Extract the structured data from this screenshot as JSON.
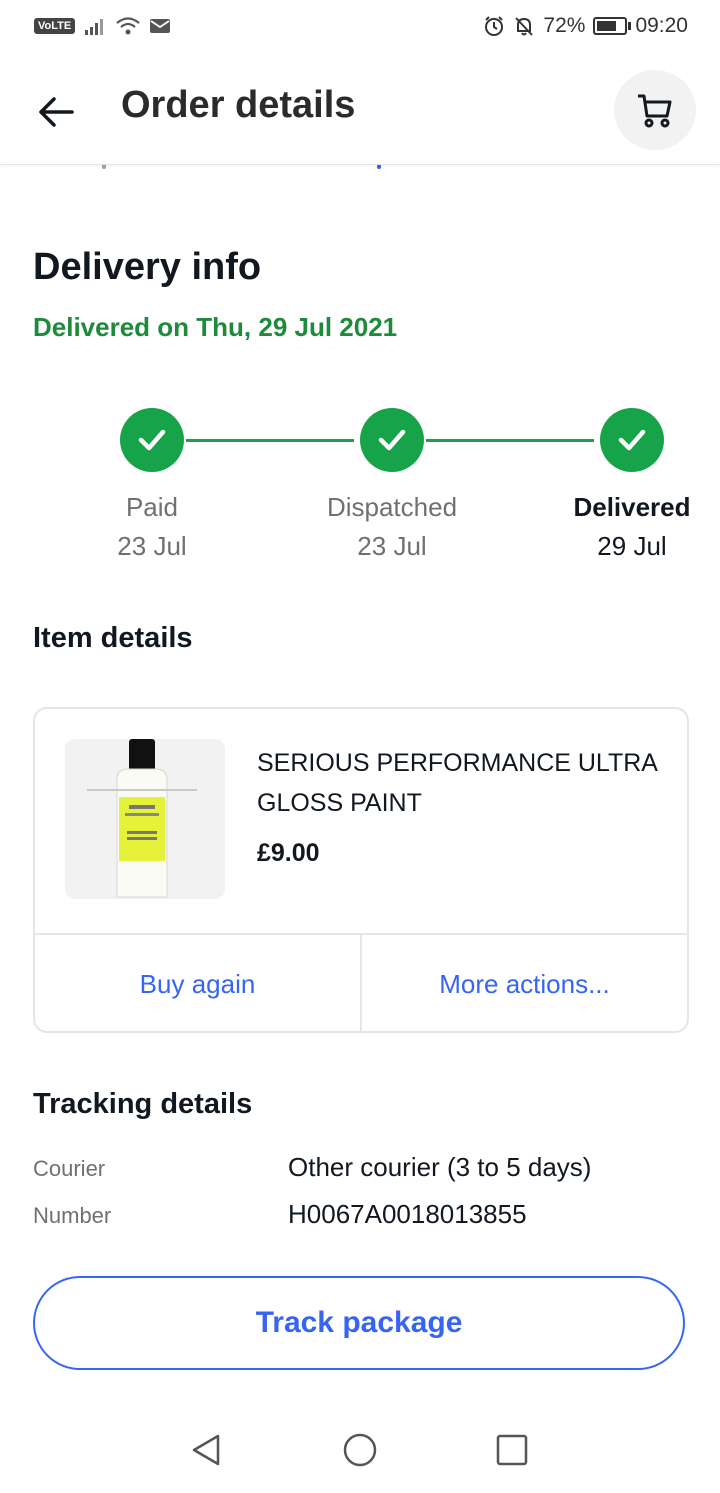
{
  "status_bar": {
    "volte": "VoLTE",
    "battery_percent": "72%",
    "battery_level": 0.72,
    "time": "09:20"
  },
  "header": {
    "title": "Order details",
    "back_icon": "arrow-left-icon",
    "cart_icon": "shopping-cart-icon"
  },
  "delivery": {
    "title": "Delivery info",
    "status": "Delivered on Thu, 29 Jul 2021",
    "accent": "#16a34a",
    "steps": [
      {
        "label": "Paid",
        "date": "23 Jul"
      },
      {
        "label": "Dispatched",
        "date": "23 Jul"
      },
      {
        "label": "Delivered",
        "date": "29 Jul"
      }
    ]
  },
  "item": {
    "section_title": "Item details",
    "name": "SERIOUS PERFORMANCE ULTRA GLOSS PAINT",
    "price": "£9.00",
    "buy_again": "Buy again",
    "more_actions": "More actions..."
  },
  "tracking": {
    "title": "Tracking details",
    "courier_label": "Courier",
    "courier_value": "Other courier (3 to 5 days)",
    "number_label": "Number",
    "number_value": "H0067A0018013855",
    "track_button": "Track package"
  },
  "colors": {
    "link": "#3665f3",
    "success": "#1e8a3c"
  }
}
